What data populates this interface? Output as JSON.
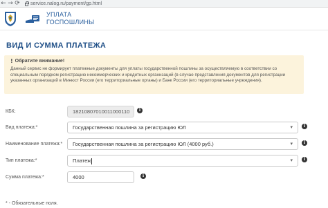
{
  "browser": {
    "back_glyph": "←",
    "forward_glyph": "→",
    "reload_glyph": "⟳",
    "url": "service.nalog.ru/payment/gp.html"
  },
  "header": {
    "brand_line1": "УПЛАТА",
    "brand_line2": "ГОСПОШЛИНЫ"
  },
  "page": {
    "title": "ВИД И СУММА ПЛАТЕЖА"
  },
  "alert": {
    "icon_glyph": "!",
    "heading": "Обратите внимание!",
    "text": "Данный сервис не формирует платежные документы для уплаты государственной пошлины за осуществляемую в соответствии со специальным порядком регистрацию некоммерческих и кредитных организаций (в случае представления документов для регистрации указанных организаций в Минюст России (его территориальные органы) и Банк России (его территориальные учреждения)."
  },
  "form": {
    "kbk": {
      "label": "КБК:",
      "value": "18210807010011000110"
    },
    "payment_kind": {
      "label": "Вид платежа:*",
      "value": "Государственная пошлина за регистрацию ЮЛ"
    },
    "payment_name": {
      "label": "Наименование платежа:*",
      "value": "Государственная пошлина за регистрацию ЮЛ (4000 руб.)"
    },
    "payment_type": {
      "label": "Тип платежа:*",
      "value": "Платеж"
    },
    "amount": {
      "label": "Сумма платежа:*",
      "value": "4000"
    },
    "info_glyph": "i",
    "caret_glyph": "▾",
    "required_note": "* - Обязательные поля."
  },
  "colors": {
    "title_blue": "#1e4e86",
    "alert_bg": "#fcf3dc"
  }
}
